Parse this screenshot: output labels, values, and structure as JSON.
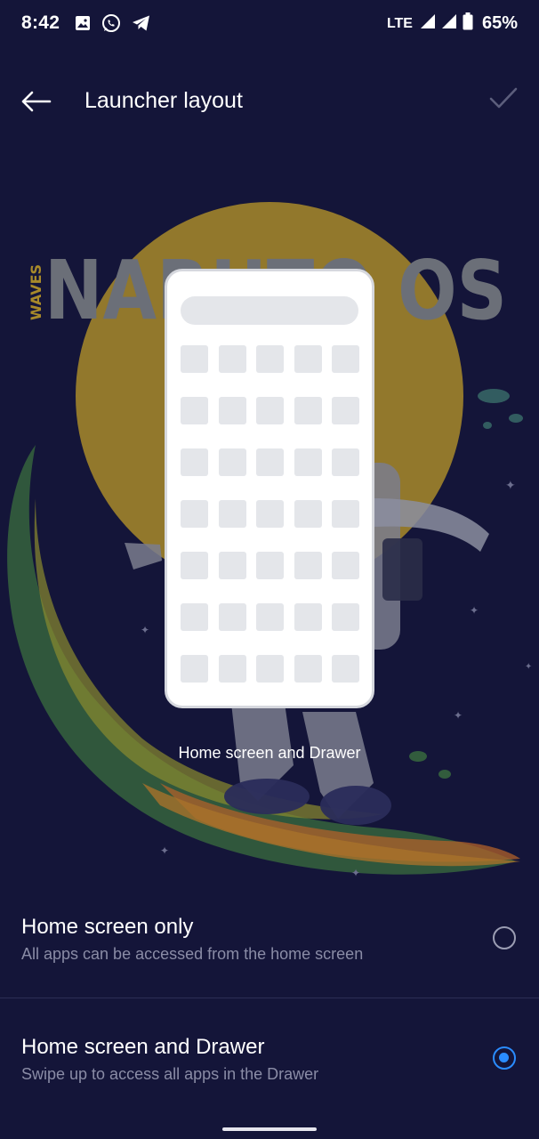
{
  "status_bar": {
    "time": "8:42",
    "network": "LTE",
    "battery": "65%",
    "left_icons": [
      "gallery-icon",
      "whatsapp-icon",
      "telegram-icon"
    ],
    "right_icons": [
      "signal-icon",
      "signal-icon",
      "battery-icon"
    ]
  },
  "app_bar": {
    "title": "Launcher layout",
    "back_icon": "arrow-left-icon",
    "confirm_icon": "checkmark-icon"
  },
  "wallpaper": {
    "brand_side": "WAVES",
    "brand_main": "NARUTO OS"
  },
  "preview": {
    "caption": "Home screen and Drawer",
    "grid_columns": 5,
    "grid_rows": 7
  },
  "options": [
    {
      "title": "Home screen only",
      "subtitle": "All apps can be accessed from the home screen",
      "selected": false
    },
    {
      "title": "Home screen and Drawer",
      "subtitle": "Swipe up to access all apps in the Drawer",
      "selected": true
    }
  ],
  "colors": {
    "background": "#141539",
    "accent": "#2a8cff",
    "muted_text": "#8a8ca6",
    "wallpaper_sun": "#c9a42a"
  }
}
